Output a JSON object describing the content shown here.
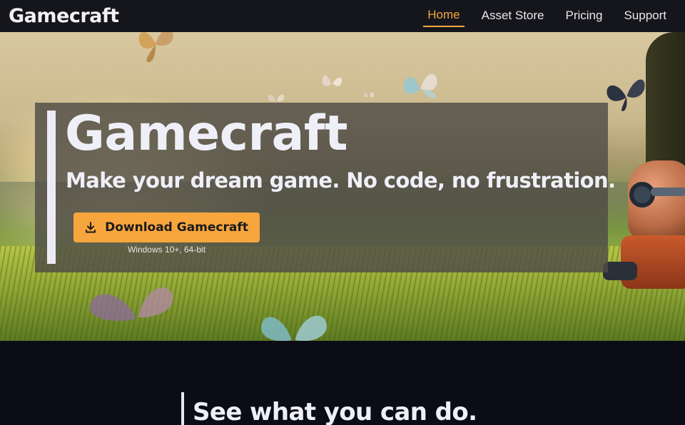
{
  "nav": {
    "logo": "Gamecraft",
    "links": [
      {
        "label": "Home",
        "active": true
      },
      {
        "label": "Asset Store",
        "active": false
      },
      {
        "label": "Pricing",
        "active": false
      },
      {
        "label": "Support",
        "active": false
      }
    ]
  },
  "hero": {
    "title": "Gamecraft",
    "subtitle": "Make your dream game. No code, no frustration.",
    "download_button": {
      "label": "Download Gamecraft",
      "icon": "download-icon"
    },
    "download_note": "Windows 10+, 64-bit"
  },
  "section": {
    "heading": "See what you can do."
  },
  "colors": {
    "accent": "#f7a53d",
    "nav_active": "#f6a83a",
    "page_background": "#0b0c16",
    "navbar_background": "#15151c"
  }
}
